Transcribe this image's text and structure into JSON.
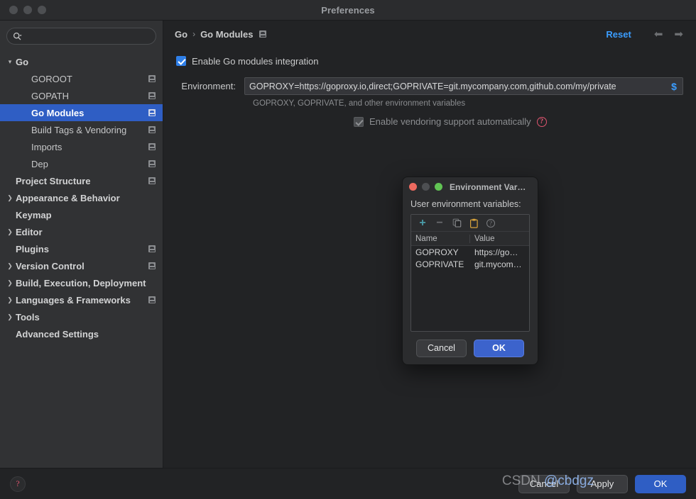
{
  "window": {
    "title": "Preferences",
    "traffic_lights": [
      "close",
      "minimize",
      "zoom"
    ]
  },
  "sidebar": {
    "search": {
      "placeholder": "",
      "value": "",
      "icon": "search-icon"
    },
    "items": [
      {
        "label": "Go",
        "depth": 0,
        "arrow": "∨",
        "badge": false,
        "selected": false
      },
      {
        "label": "GOROOT",
        "depth": 1,
        "arrow": "",
        "badge": true,
        "selected": false
      },
      {
        "label": "GOPATH",
        "depth": 1,
        "arrow": "",
        "badge": true,
        "selected": false
      },
      {
        "label": "Go Modules",
        "depth": 1,
        "arrow": "",
        "badge": true,
        "selected": true
      },
      {
        "label": "Build Tags & Vendoring",
        "depth": 1,
        "arrow": "",
        "badge": true,
        "selected": false
      },
      {
        "label": "Imports",
        "depth": 1,
        "arrow": "",
        "badge": true,
        "selected": false
      },
      {
        "label": "Dep",
        "depth": 1,
        "arrow": "",
        "badge": true,
        "selected": false
      },
      {
        "label": "Project Structure",
        "depth": 2,
        "arrow": "",
        "badge": true,
        "selected": false
      },
      {
        "label": "Appearance & Behavior",
        "depth": 0,
        "arrow": "›",
        "badge": false,
        "selected": false
      },
      {
        "label": "Keymap",
        "depth": 2,
        "arrow": "",
        "badge": false,
        "selected": false
      },
      {
        "label": "Editor",
        "depth": 0,
        "arrow": "›",
        "badge": false,
        "selected": false
      },
      {
        "label": "Plugins",
        "depth": 2,
        "arrow": "",
        "badge": true,
        "selected": false
      },
      {
        "label": "Version Control",
        "depth": 0,
        "arrow": "›",
        "badge": true,
        "selected": false
      },
      {
        "label": "Build, Execution, Deployment",
        "depth": 0,
        "arrow": "›",
        "badge": false,
        "selected": false
      },
      {
        "label": "Languages & Frameworks",
        "depth": 0,
        "arrow": "›",
        "badge": true,
        "selected": false
      },
      {
        "label": "Tools",
        "depth": 0,
        "arrow": "›",
        "badge": false,
        "selected": false
      },
      {
        "label": "Advanced Settings",
        "depth": 2,
        "arrow": "",
        "badge": false,
        "selected": false
      }
    ]
  },
  "main": {
    "breadcrumb": {
      "root": "Go",
      "separator": "›",
      "current": "Go Modules",
      "badge_icon": "project-scope-icon"
    },
    "reset_label": "Reset",
    "nav_back_icon": "arrow-left-icon",
    "nav_forward_icon": "arrow-right-icon",
    "enable_modules": {
      "label": "Enable Go modules integration",
      "checked": true,
      "disabled": false
    },
    "environment": {
      "label": "Environment:",
      "value": "GOPROXY=https://goproxy.io,direct;GOPRIVATE=git.mycompany.com,github.com/my/private",
      "placeholder": "",
      "macro_button": "$",
      "hint": "GOPROXY, GOPRIVATE, and other environment variables"
    },
    "vendoring": {
      "label": "Enable vendoring support automatically",
      "checked": true,
      "disabled": true,
      "help_icon": "help-circle-icon",
      "help_glyph": "?"
    }
  },
  "footer": {
    "help_icon": "help-circle-icon",
    "help_glyph": "?",
    "cancel_label": "Cancel",
    "apply_label": "Apply",
    "ok_label": "OK"
  },
  "modal": {
    "title": "Environment Var…",
    "subtitle": "User environment variables:",
    "toolbar": [
      {
        "name": "add-variable-button",
        "glyph": "+",
        "state": "enabled"
      },
      {
        "name": "remove-variable-button",
        "glyph": "−",
        "state": "disabled"
      },
      {
        "name": "copy-button",
        "glyph": "copy",
        "state": "disabled"
      },
      {
        "name": "paste-button",
        "glyph": "paste",
        "state": "enabled"
      },
      {
        "name": "help-button",
        "glyph": "?",
        "state": "enabled"
      }
    ],
    "table": {
      "columns": [
        "Name",
        "Value"
      ],
      "rows": [
        {
          "name": "GOPROXY",
          "value": "https://go…"
        },
        {
          "name": "GOPRIVATE",
          "value": "git.mycom…"
        }
      ]
    },
    "cancel_label": "Cancel",
    "ok_label": "OK"
  },
  "watermark": {
    "text1": "CSDN ",
    "text2": "@cbdgz"
  },
  "colors": {
    "accent_blue": "#2f5ec4",
    "link_blue": "#3b9dff",
    "checkbox_blue": "#2f7fe8",
    "sidebar_bg": "#313234",
    "main_bg": "#222325",
    "help_red": "#e05570",
    "toolbar_plus": "#4a9ca8",
    "paste_gold": "#d8a33c"
  }
}
